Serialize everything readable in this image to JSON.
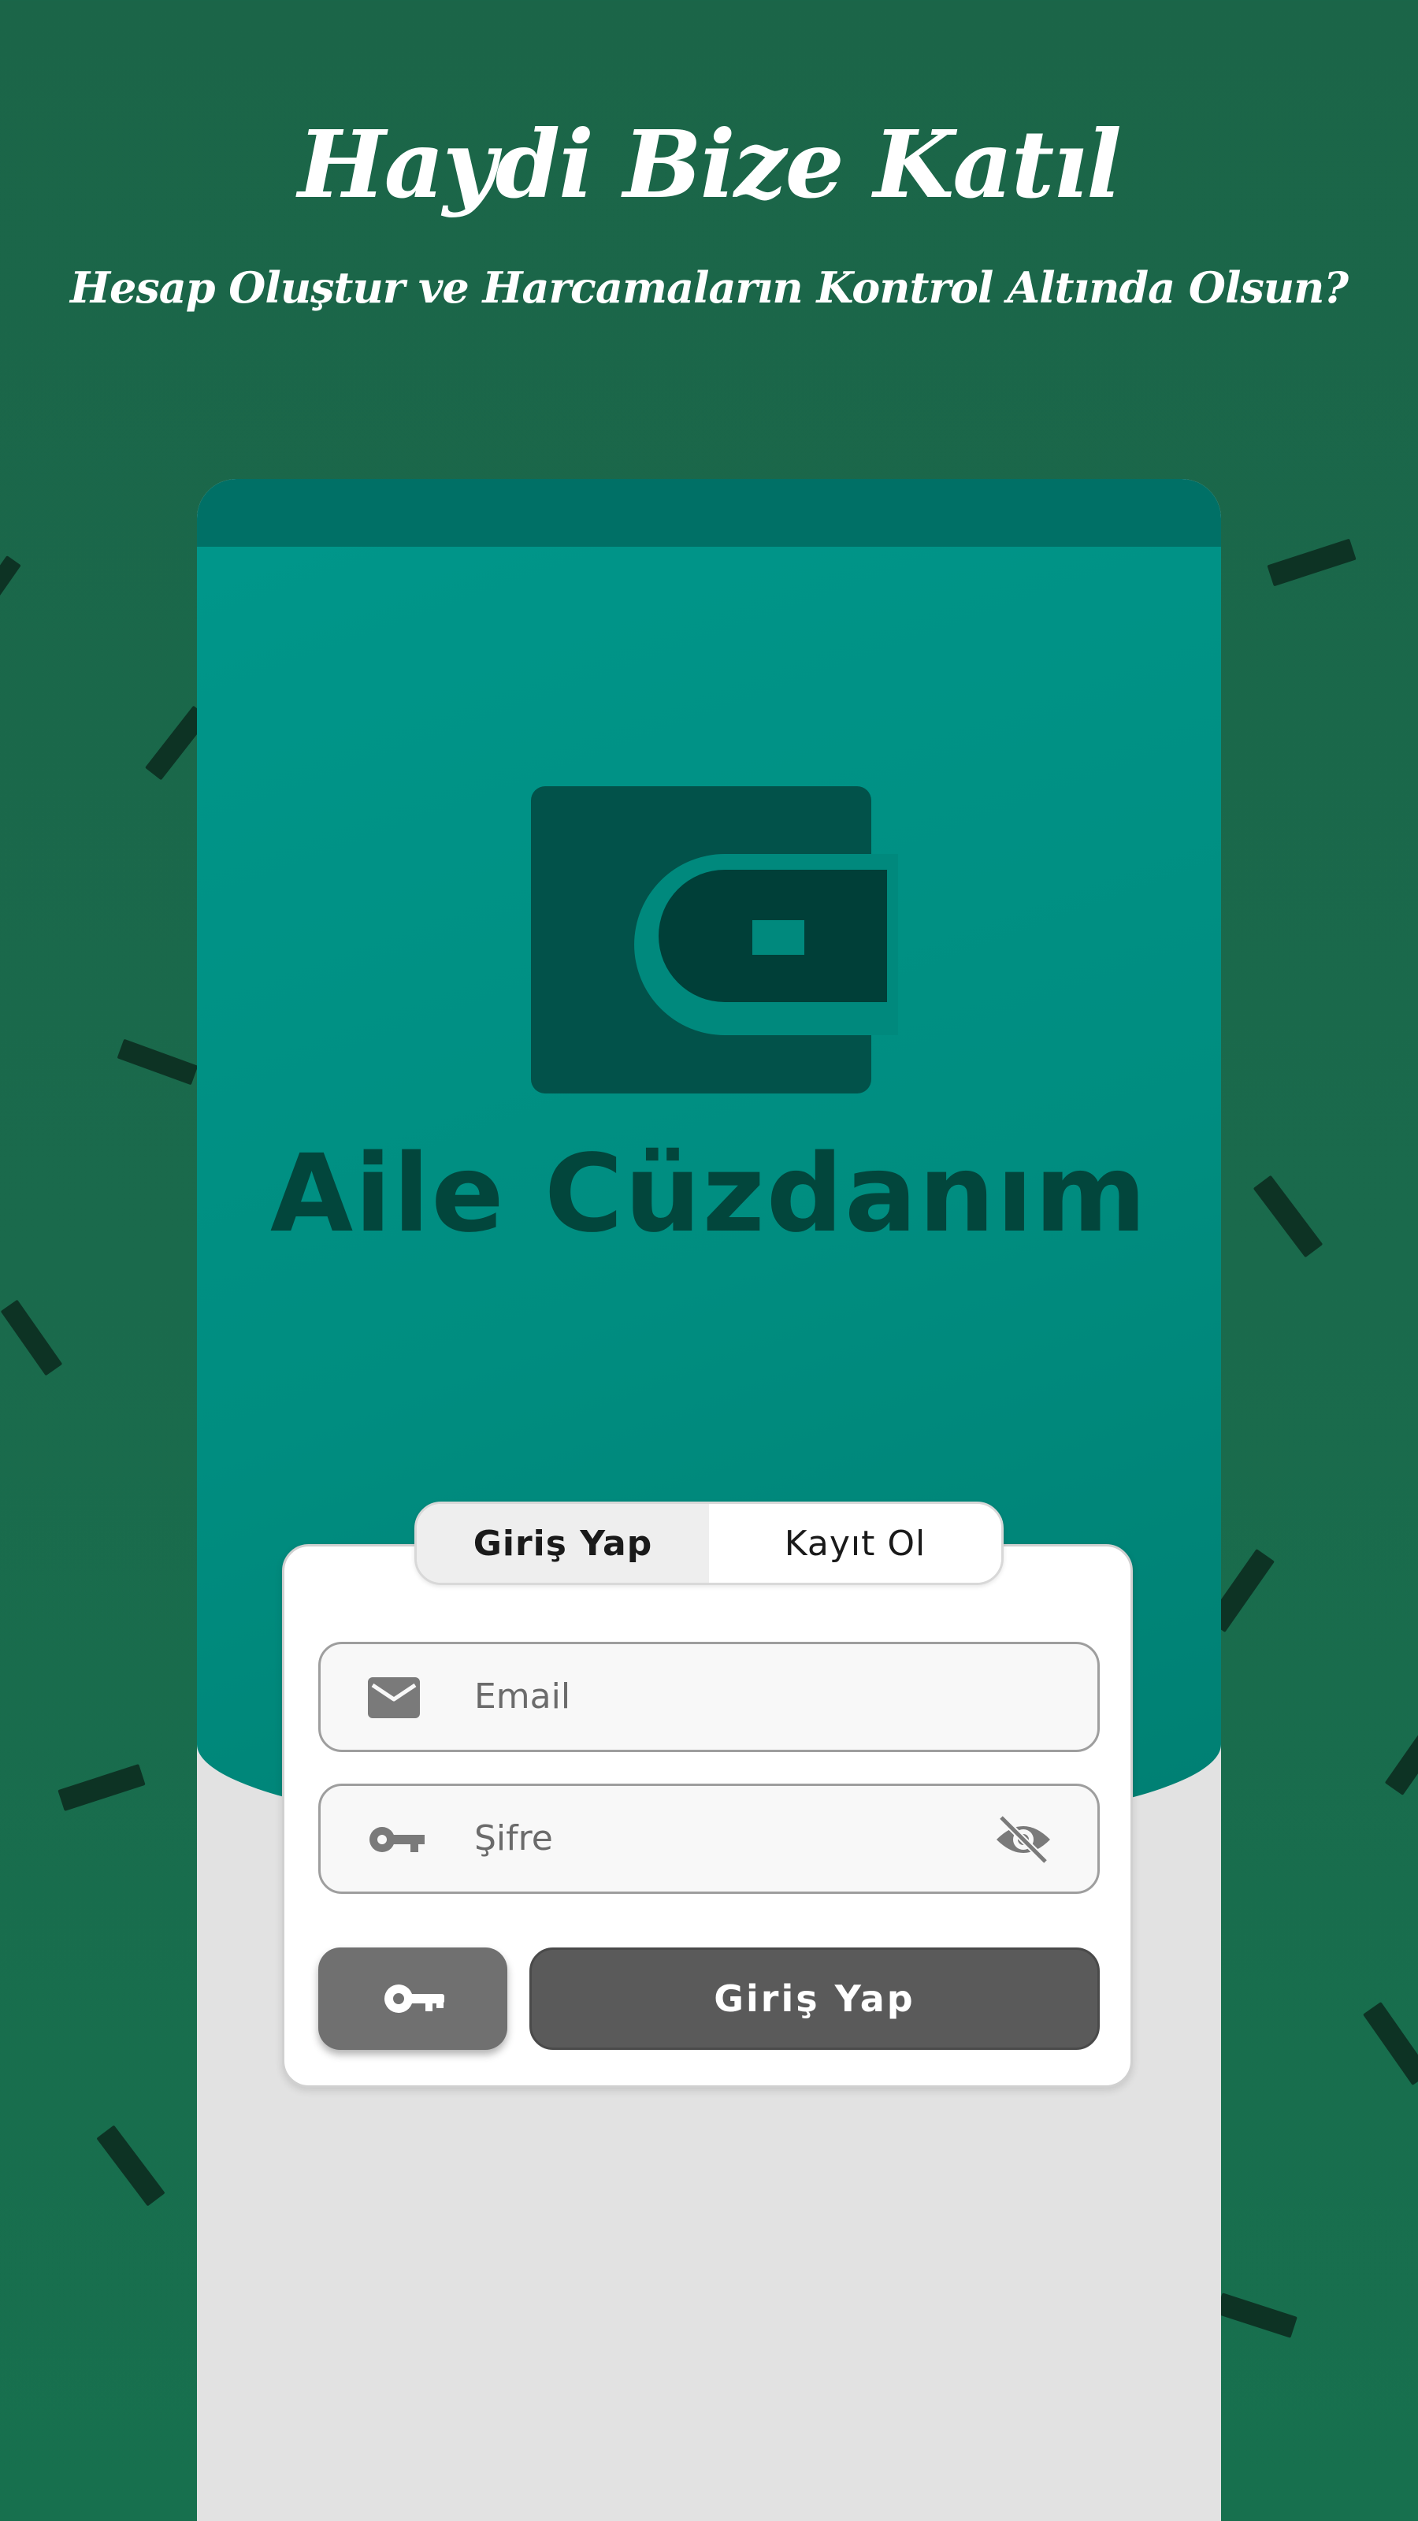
{
  "promo": {
    "title": "Haydi Bize Katıl",
    "subtitle": "Hesap Oluştur ve Harcamaların Kontrol Altında Olsun?"
  },
  "app": {
    "name": "Aile Cüzdanım",
    "logo_icon": "wallet-icon"
  },
  "tabs": [
    {
      "label": "Giriş Yap",
      "active": true
    },
    {
      "label": "Kayıt Ol",
      "active": false
    }
  ],
  "form": {
    "email": {
      "placeholder": "Email",
      "value": "",
      "icon": "envelope-icon"
    },
    "password": {
      "placeholder": "Şifre",
      "value": "",
      "icon": "key-icon",
      "toggle_icon": "eye-off-icon"
    },
    "key_button_icon": "key-icon",
    "login_label": "Giriş Yap"
  },
  "colors": {
    "background": "#1b6548",
    "hero": "#00968a",
    "status_bar": "#007066",
    "logo_dark": "#02463c",
    "button": "#5a5a5a"
  }
}
